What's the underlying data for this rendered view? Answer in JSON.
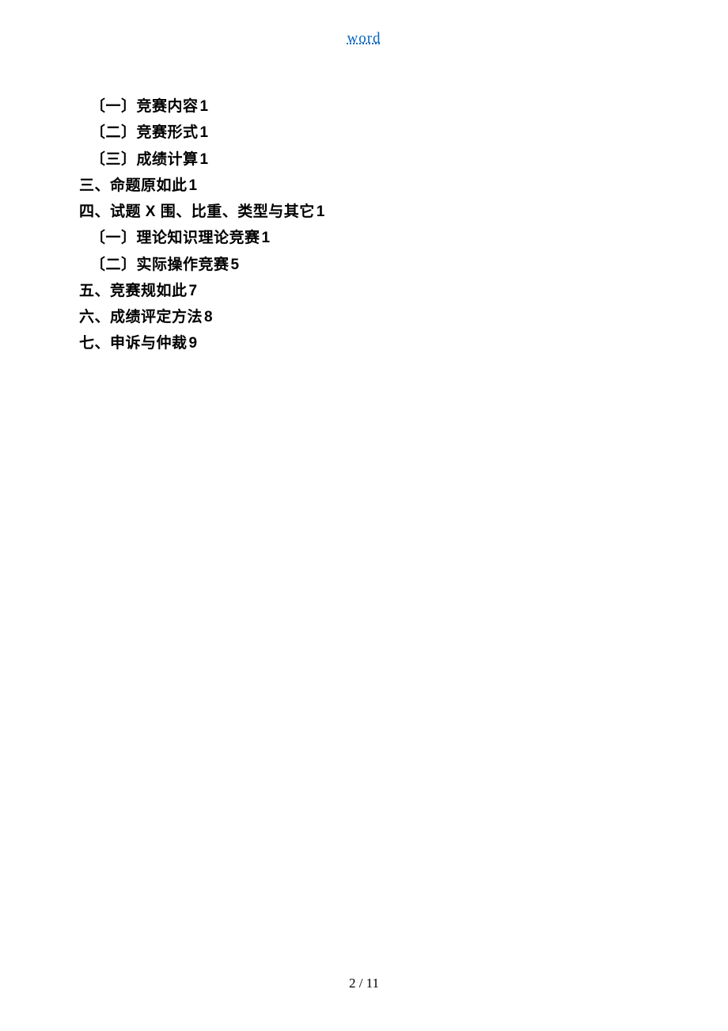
{
  "header": {
    "link_text": "word"
  },
  "toc": {
    "items": [
      {
        "level": 2,
        "text": "〔一〕竞赛内容",
        "page": "1"
      },
      {
        "level": 2,
        "text": "〔二〕竞赛形式",
        "page": "1"
      },
      {
        "level": 2,
        "text": "〔三〕成绩计算",
        "page": "1"
      },
      {
        "level": 1,
        "text": "三、命题原如此",
        "page": "1"
      },
      {
        "level": 1,
        "text_pre": "四、试题 ",
        "x": "X",
        "text_post": " 围、比重、类型与其它",
        "page": "1"
      },
      {
        "level": 2,
        "text": "〔一〕理论知识理论竞赛",
        "page": "1"
      },
      {
        "level": 2,
        "text": "〔二〕实际操作竞赛",
        "page": "5"
      },
      {
        "level": 1,
        "text": "五、竞赛规如此",
        "page": "7"
      },
      {
        "level": 1,
        "text": "六、成绩评定方法",
        "page": "8"
      },
      {
        "level": 1,
        "text": "七、申诉与仲裁",
        "page": "9"
      }
    ]
  },
  "footer": {
    "current_page": "2",
    "separator": " / ",
    "total_pages": "11"
  }
}
